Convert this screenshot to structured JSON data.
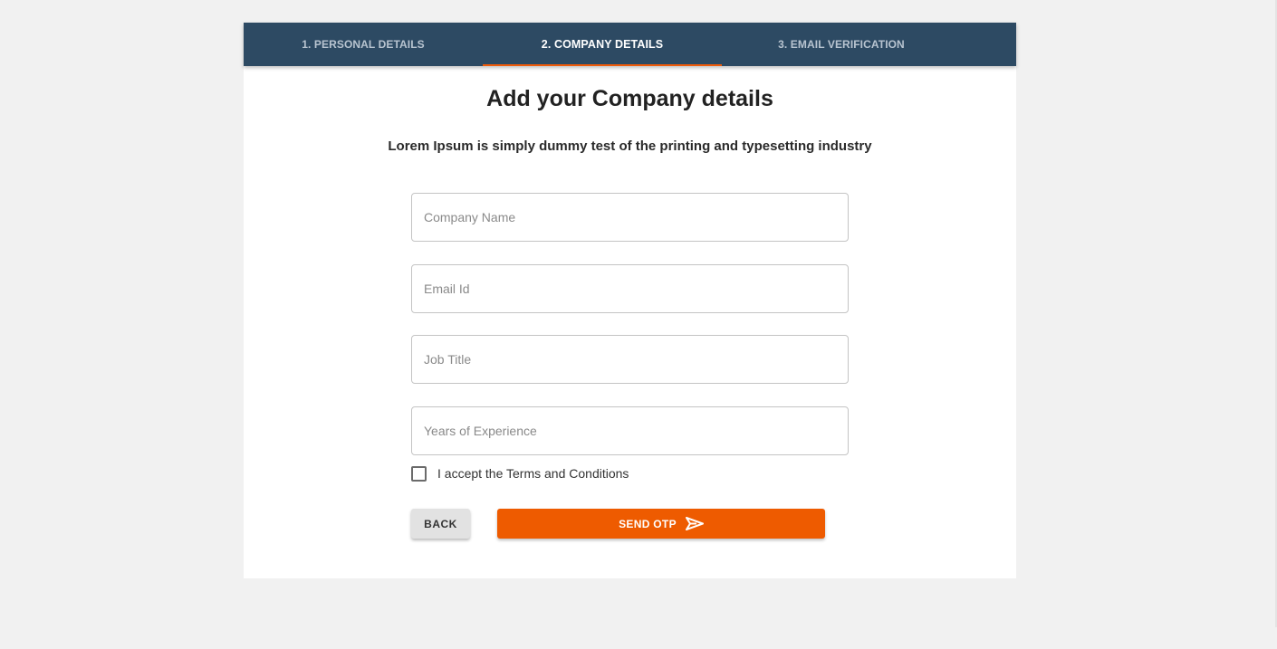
{
  "stepper": {
    "tabs": [
      {
        "label": "1. PERSONAL DETAILS"
      },
      {
        "label": "2. COMPANY DETAILS"
      },
      {
        "label": "3. EMAIL VERIFICATION"
      }
    ],
    "active_index": 1
  },
  "form": {
    "title": "Add your Company details",
    "subtitle": "Lorem Ipsum is simply dummy test of the printing and typesetting industry",
    "fields": [
      {
        "placeholder": "Company Name",
        "value": ""
      },
      {
        "placeholder": "Email Id",
        "value": ""
      },
      {
        "placeholder": "Job Title",
        "value": ""
      },
      {
        "placeholder": "Years of Experience",
        "value": ""
      }
    ],
    "terms_label": "I accept the Terms and Conditions",
    "terms_checked": false,
    "back_label": "BACK",
    "send_label": "SEND OTP",
    "send_icon": "send-icon"
  },
  "colors": {
    "header_bg": "#2d4a63",
    "accent": "#ee5b00",
    "page_bg": "#f1f1f1"
  }
}
